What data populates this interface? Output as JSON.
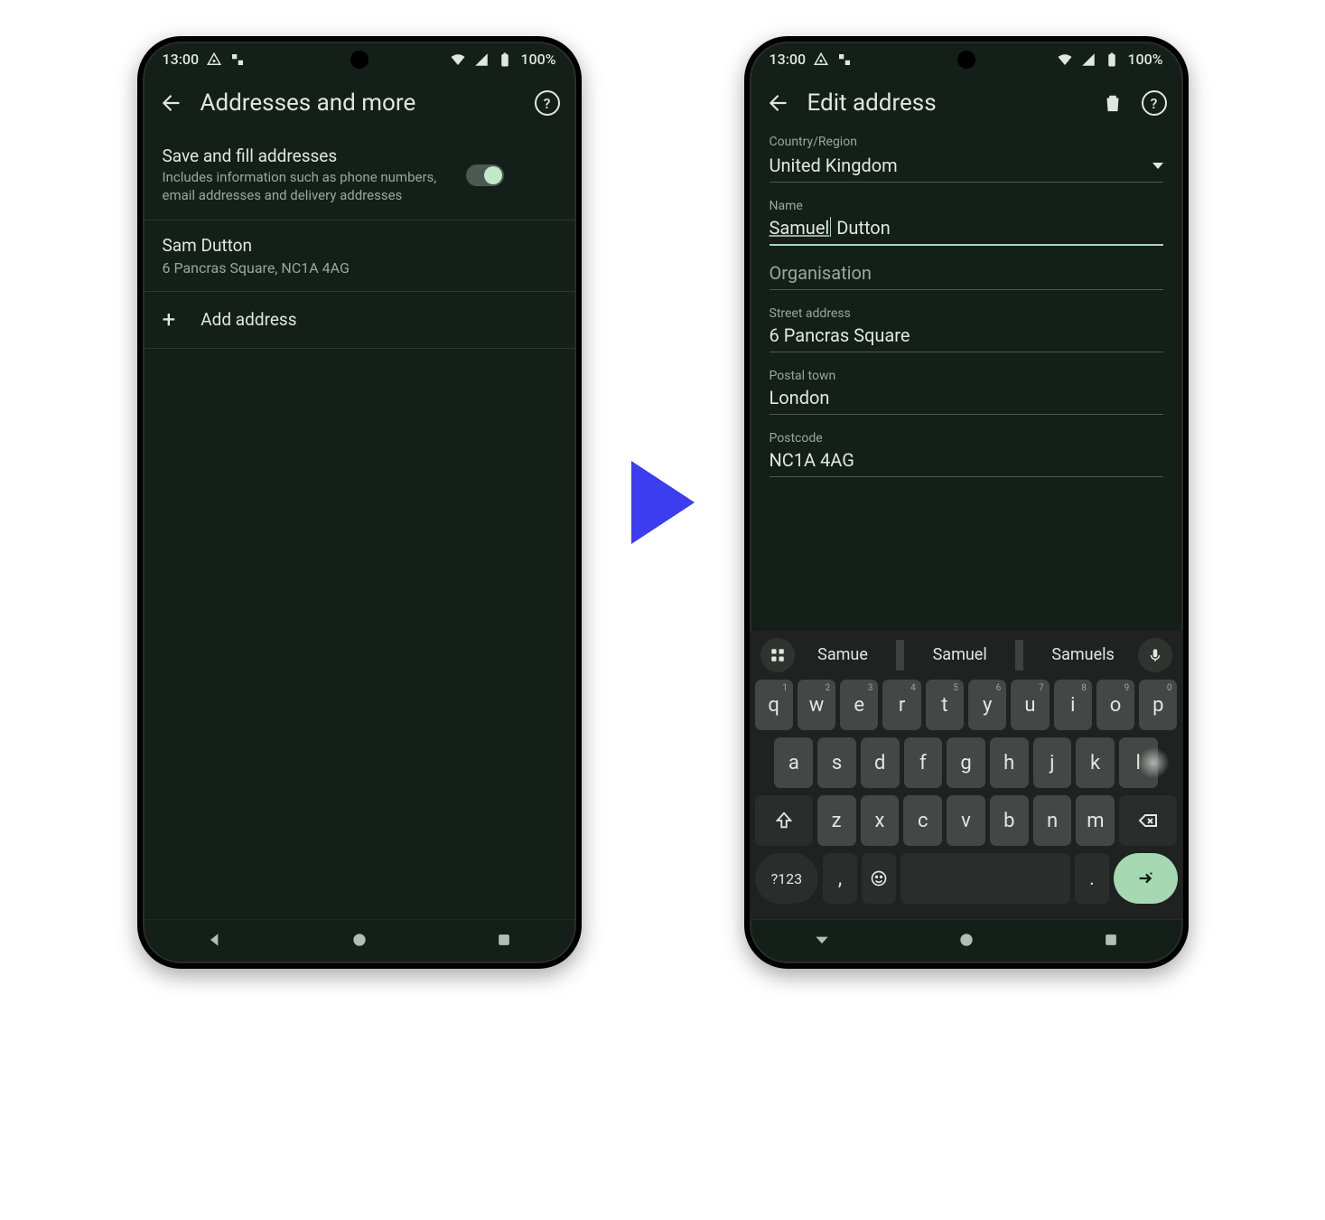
{
  "status": {
    "time": "13:00",
    "battery": "100%"
  },
  "left": {
    "title": "Addresses and more",
    "setting_title": "Save and fill addresses",
    "setting_desc": "Includes information such as phone numbers, email addresses and delivery addresses",
    "entry_name": "Sam Dutton",
    "entry_addr": "6 Pancras Square, NC1A 4AG",
    "add_label": "Add address"
  },
  "right": {
    "title": "Edit address",
    "fields": {
      "country_label": "Country/Region",
      "country_value": "United Kingdom",
      "name_label": "Name",
      "name_first": "Samuel",
      "name_last": "Dutton",
      "org_label": "Organisation",
      "street_label": "Street address",
      "street_value": "6 Pancras Square",
      "town_label": "Postal town",
      "town_value": "London",
      "post_label": "Postcode",
      "post_value": "NC1A 4AG"
    },
    "suggestions": [
      "Samue",
      "Samuel",
      "Samuels"
    ],
    "kbd": {
      "r1": [
        [
          "q",
          "1"
        ],
        [
          "w",
          "2"
        ],
        [
          "e",
          "3"
        ],
        [
          "r",
          "4"
        ],
        [
          "t",
          "5"
        ],
        [
          "y",
          "6"
        ],
        [
          "u",
          "7"
        ],
        [
          "i",
          "8"
        ],
        [
          "o",
          "9"
        ],
        [
          "p",
          "0"
        ]
      ],
      "r2": [
        "a",
        "s",
        "d",
        "f",
        "g",
        "h",
        "j",
        "k",
        "l"
      ],
      "r3": [
        "z",
        "x",
        "c",
        "v",
        "b",
        "n",
        "m"
      ],
      "numkey": "?123",
      "comma": ",",
      "period": "."
    }
  }
}
